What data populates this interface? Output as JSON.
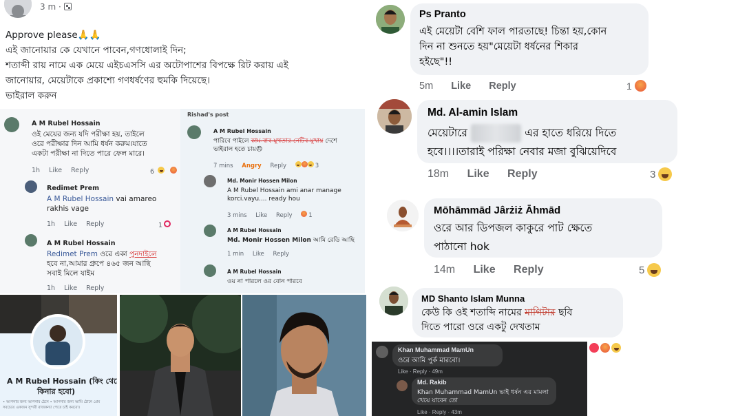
{
  "post": {
    "time": "3 m",
    "privacy_icon": "group-icon",
    "lines": [
      "Approve please🙏🙏",
      "এই জানোয়ার কে যেখানে পাবেন,গণধোলাই দিন;",
      "শতাব্দী রায় নামে এক মেয়ে এইচএসসি এর অটোপাশের বিপক্ষে রিট করায় এই",
      "জানোয়ার, মেয়েটাকে প্রকাশ্যে গণধর্ষণের হুমকি দিয়েছে।",
      "ভাইরাল করুন"
    ]
  },
  "shot_a": {
    "c1_name": "A M Rubel Hossain",
    "c1_text": [
      "ওই মেয়ের জন্য যদি পরীক্ষা হয়, তাইলে",
      "ওরে পরীক্ষার দিন আমি ধর্ষন করুম।যাতে",
      "একটা পরীক্ষা না দিতে পারে ফেল মারে।"
    ],
    "c1_time": "1h",
    "c1_like": "Like",
    "c1_reply": "Reply",
    "c1_count": "6",
    "c2_name": "Redimet Prem",
    "c2_mention": "A M Rubel Hossain",
    "c2_text": " vai amareo",
    "c2_text2": "rakhis vage",
    "c2_time": "1h",
    "c2_like": "Like",
    "c2_reply": "Reply",
    "c2_count": "1",
    "c3_name": "A M Rubel Hossain",
    "c3_mention": "Redimet Prem",
    "c3_text": " ওরে একা ",
    "c3_red": "পুনদাইলে",
    "c3_text2": "হবে না,আমার গ্রুপে ৪৬৫ জন আছি",
    "c3_text3": "সবাই মিলে যাইম",
    "c3_time": "1h",
    "c3_like": "Like",
    "c3_reply": "Reply"
  },
  "shot_b": {
    "tag": "Rishad's post",
    "c1_name": "A M Rubel Hossain",
    "c1_text": "পারিবে পাইলে ",
    "c1_red": "কাম-বাব-মুখতার-নেটিব-মুখায়",
    "c1_text_end": " দেশে",
    "c1_text2": "ভাইরাল হতে চায়😠",
    "c1_time": "7 mins",
    "c1_react": "Angry",
    "c1_reply": "Reply",
    "c1_count": "3",
    "c2_name": "Md. Monir Hossen Milon",
    "c2_mention": "A M Rubel Hossain",
    "c2_text": " ami anar manage",
    "c2_text2": "korci.vayu.... ready hou",
    "c2_time": "3 mins",
    "c2_like": "Like",
    "c2_reply": "Reply",
    "c2_count": "1",
    "c3_name": "A M Rubel Hossain",
    "c3_mention": "Md. Monir Hossen Milon",
    "c3_text": " আমি রেডি আছি",
    "c3_time": "1 min",
    "c3_like": "Like",
    "c3_reply": "Reply",
    "c4_name": "A M Rubel Hossain",
    "c4_text": "ওয় না পারলে ওর বোন পারবে"
  },
  "profile_card": {
    "name": "A M Rubel Hossain (কিং থেকে",
    "name2": "কিনার হবো)",
    "bio": "• আপনার জন্য আপনার ঠেনে • আপনার জন্য আমি ঠোনে প্রেম",
    "bio2": "সবচেয়ে একজন সুন্দরী রাজকন্যা পেতে চাই করবো।"
  },
  "comments": [
    {
      "name": "Ps Pranto",
      "lines": [
        "এই মেয়েটা বেশি ফাল পারতাছে! চিন্তা হয়,কোন",
        "দিন না শুনতে হয়\"মেয়েটা ধর্ষনের শিকার",
        "হইছে\"!!"
      ],
      "time": "5m",
      "like": "Like",
      "reply": "Reply",
      "count": "1",
      "reaction_icon": "angry-reaction-icon"
    },
    {
      "name": "Md. Al-amin Islam",
      "line1_start": "মেয়েটারে ",
      "line1_blur": "xxxxxxxx",
      "line1_end": " এর হাতে ধরিয়ে দিতে",
      "line2": "হবে।।।।তারাই পরিক্ষা নেবার মজা বুঝিয়েদিবে",
      "time": "18m",
      "like": "Like",
      "reply": "Reply",
      "count": "3",
      "reaction_icon": "haha-reaction-icon"
    },
    {
      "name": "Mōhāmmād Jârżiż Āhmād",
      "lines": [
        "ওরে আর ডিপজল কাকুরে পাট ক্ষেতে",
        "পাঠানো hok"
      ],
      "time": "14m",
      "like": "Like",
      "reply": "Reply",
      "count": "5",
      "reaction_icon": "haha-reaction-icon"
    },
    {
      "name": "MD Shanto Islam Munna",
      "line1_start": "কেউ কি ওই শতাব্দি নামের ",
      "line1_red": "মাগিটার",
      "line1_end": " ছবি",
      "line2": "দিতে পারো ওরে একটু দেখতাম"
    }
  ],
  "dark_shot": {
    "c1_name": "Khan Muhammad MamUn",
    "c1_text": "ওরে আমি পুর্ক মারবো।",
    "c1_acts": "Like · Reply · 49m",
    "c2_name": "Md. Rakib",
    "c2_text": "Khan Muhammad MamUn ভাই ধর্ষন এর মামলা",
    "c2_text2": "খেয়ে যাবেন তো",
    "c2_acts": "Like · Reply · 43m"
  }
}
